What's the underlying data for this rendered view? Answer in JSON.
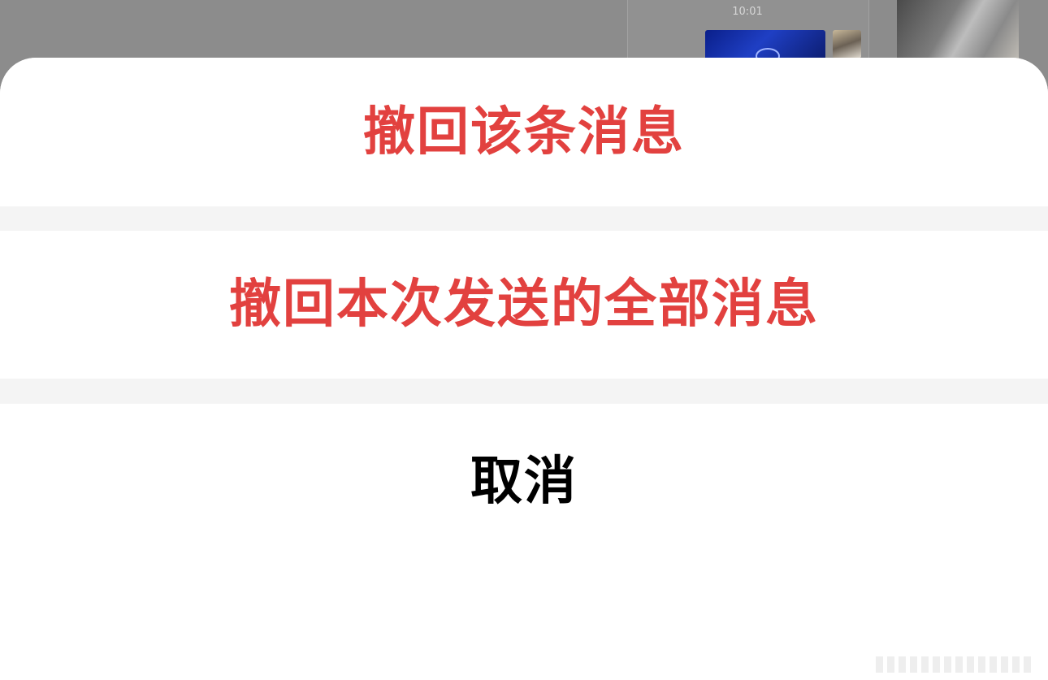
{
  "background_chat": {
    "timestamp": "10:01"
  },
  "action_sheet": {
    "options": [
      {
        "label": "撤回该条消息",
        "style": "destructive"
      },
      {
        "label": "撤回本次发送的全部消息",
        "style": "destructive"
      }
    ],
    "cancel_label": "取消"
  },
  "colors": {
    "destructive": "#e2413f",
    "cancel": "#000000",
    "separator": "#f4f4f4",
    "dim_overlay": "#8c8c8c"
  }
}
